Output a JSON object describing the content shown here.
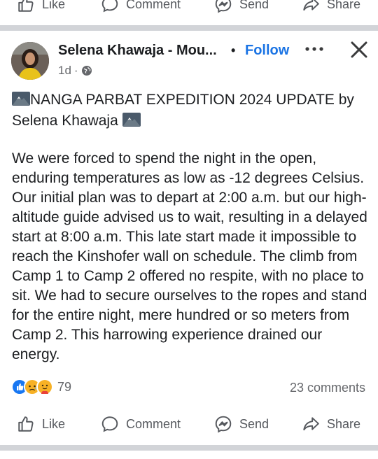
{
  "actions": {
    "like": "Like",
    "comment": "Comment",
    "send": "Send",
    "share": "Share"
  },
  "post": {
    "author": "Selena Khawaja - Mou...",
    "separator": "•",
    "follow_label": "Follow",
    "time": "1d",
    "meta_separator": "·",
    "title_part1": "NANGA PARBAT EXPEDITION 2024 UPDATE by Selena Khawaja",
    "body": "We were forced to spend the night in the open, enduring temperatures as low as -12 degrees Celsius. Our initial plan was to depart at 2:00 a.m. but our high-altitude guide advised us to wait, resulting in a delayed start at 8:00 a.m. This late start made it impossible to reach the Kinshofer wall on schedule. The climb from Camp 1 to Camp 2 offered no respite, with no place to sit. We had to secure ourselves to the ropes and stand for the entire night, mere hundred or so meters from Camp 2. This harrowing experience drained our energy.",
    "reaction_count": "79",
    "comments_count": "23 comments"
  },
  "icons": {
    "like": "thumbs-up-icon",
    "comment": "speech-bubble-icon",
    "send": "messenger-icon",
    "share": "share-arrow-icon",
    "more": "more-dots-icon",
    "close": "close-icon",
    "privacy": "globe-icon",
    "title_emoji": "mountain-icon",
    "reactions": [
      "like-reaction-icon",
      "sad-reaction-icon",
      "care-reaction-icon"
    ]
  },
  "colors": {
    "follow": "#1b74e4",
    "like_reaction": "#1877f2",
    "sad_reaction": "#f7b125",
    "divider": "#d2d4d8"
  }
}
